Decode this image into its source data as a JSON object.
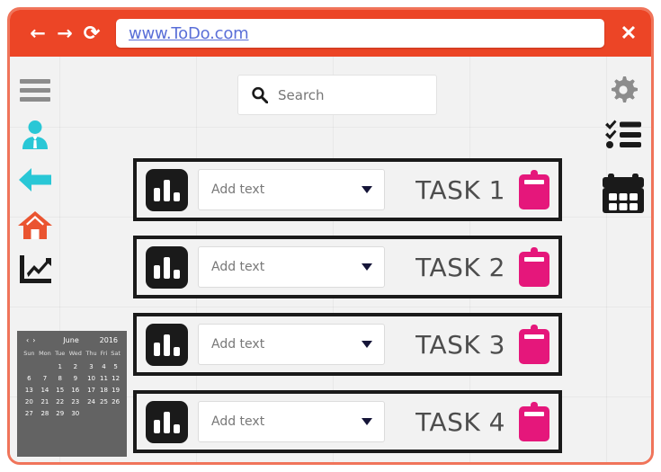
{
  "browser": {
    "back_label": "←",
    "forward_label": "→",
    "reload_label": "⟳",
    "close_label": "✕",
    "address_value": "www.ToDo.com",
    "address_placeholder": "Enter address",
    "bar_color": "#ec4526"
  },
  "search": {
    "placeholder": "Search",
    "value": "",
    "icon": "search-icon"
  },
  "left_rail": {
    "items": [
      {
        "icon": "hamburger-menu-icon",
        "color": "#8c8c8c"
      },
      {
        "icon": "user-person-icon",
        "color": "#29c7d6"
      },
      {
        "icon": "back-arrow-icon",
        "color": "#29c7d6"
      },
      {
        "icon": "home-icon",
        "color": "#ea5430"
      },
      {
        "icon": "line-chart-icon",
        "color": "#1a1a1a"
      }
    ]
  },
  "right_rail": {
    "items": [
      {
        "icon": "gear-settings-icon",
        "color": "#8c8c8c"
      },
      {
        "icon": "checklist-icon",
        "color": "#1a1a1a"
      },
      {
        "icon": "calendar-icon",
        "color": "#1a1a1a"
      }
    ]
  },
  "tasks": {
    "dropdown_placeholder": "Add text",
    "dropdown_value": "",
    "clipboard_color": "#e5177b",
    "rows": [
      {
        "label": "TASK 1"
      },
      {
        "label": "TASK 2"
      },
      {
        "label": "TASK 3"
      },
      {
        "label": "TASK 4"
      }
    ]
  },
  "calendar": {
    "month": "June",
    "year": "2016",
    "prev_label": "‹",
    "next_label": "›",
    "weekdays": [
      "Sun",
      "Mon",
      "Tue",
      "Wed",
      "Thu",
      "Fri",
      "Sat"
    ],
    "weeks": [
      [
        "",
        "",
        "1",
        "2",
        "3",
        "4",
        "5"
      ],
      [
        "6",
        "7",
        "8",
        "9",
        "10",
        "11",
        "12"
      ],
      [
        "13",
        "14",
        "15",
        "16",
        "17",
        "18",
        "19"
      ],
      [
        "20",
        "21",
        "22",
        "23",
        "24",
        "25",
        "26"
      ],
      [
        "27",
        "28",
        "29",
        "30",
        "",
        "",
        ""
      ]
    ]
  }
}
